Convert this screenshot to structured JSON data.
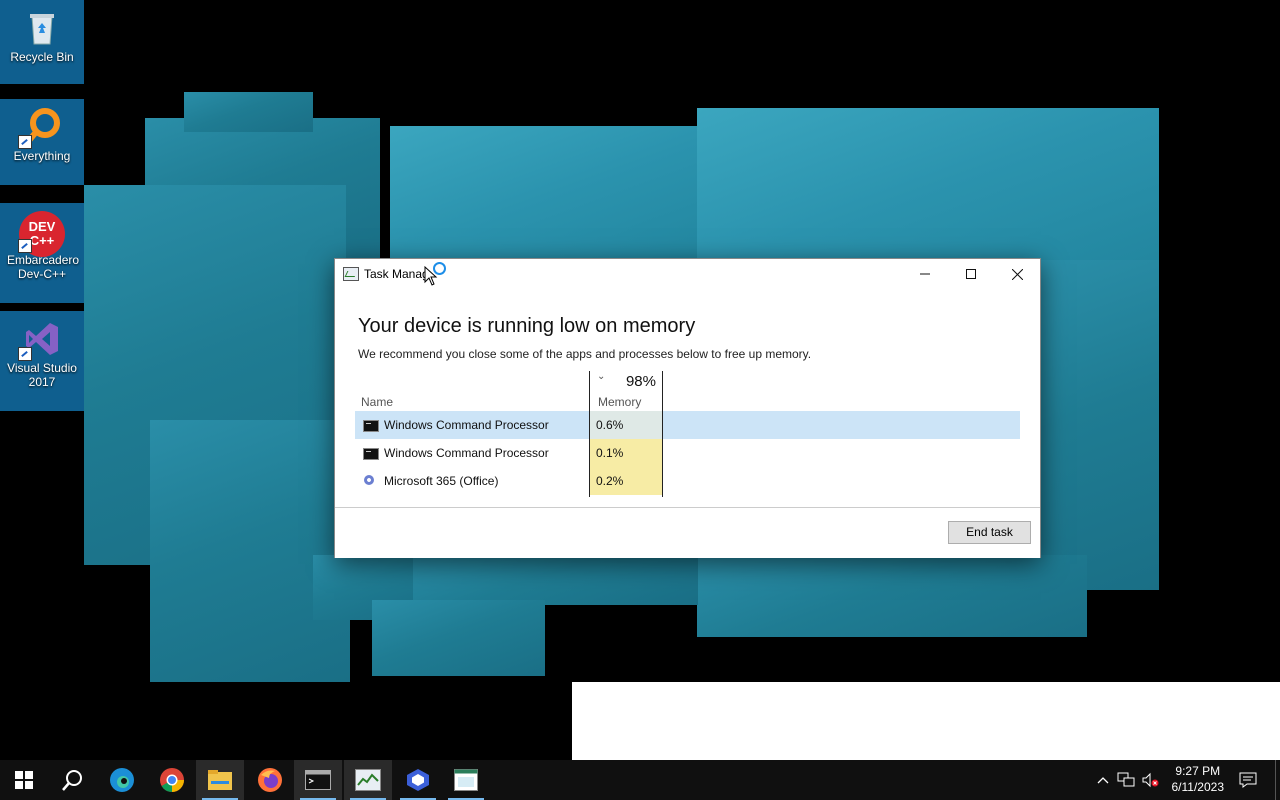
{
  "desktop": {
    "icons": [
      {
        "label": "Recycle Bin"
      },
      {
        "label": "Everything"
      },
      {
        "label": "Embarcadero Dev-C++",
        "badge": "DEV C++"
      },
      {
        "label": "Visual Studio 2017"
      }
    ]
  },
  "dialog": {
    "title": "Task Manag",
    "heading": "Your device is running low on memory",
    "subtext": "We recommend you close some of the apps and processes below to free up memory.",
    "columns": {
      "name": "Name",
      "memory": "Memory",
      "memory_total": "98%"
    },
    "rows": [
      {
        "name": "Windows Command Processor",
        "memory": "0.6%",
        "icon": "cmd-icon",
        "selected": true
      },
      {
        "name": "Windows Command Processor",
        "memory": "0.1%",
        "icon": "cmd-icon",
        "selected": false
      },
      {
        "name": "Microsoft 365 (Office)",
        "memory": "0.2%",
        "icon": "office-icon",
        "selected": false
      }
    ],
    "end_task_label": "End task"
  },
  "taskbar": {
    "apps": [
      "start",
      "search",
      "edge",
      "chrome",
      "file-explorer",
      "firefox",
      "command-prompt",
      "task-manager",
      "microsoft-365",
      "notepad-window"
    ],
    "clock": {
      "time": "9:27 PM",
      "date": "6/11/2023"
    }
  },
  "colors": {
    "selection": "#cce4f7",
    "memory_heat": "#f7eca5",
    "taskbar": "#101010",
    "accent": "#76b9ed"
  }
}
